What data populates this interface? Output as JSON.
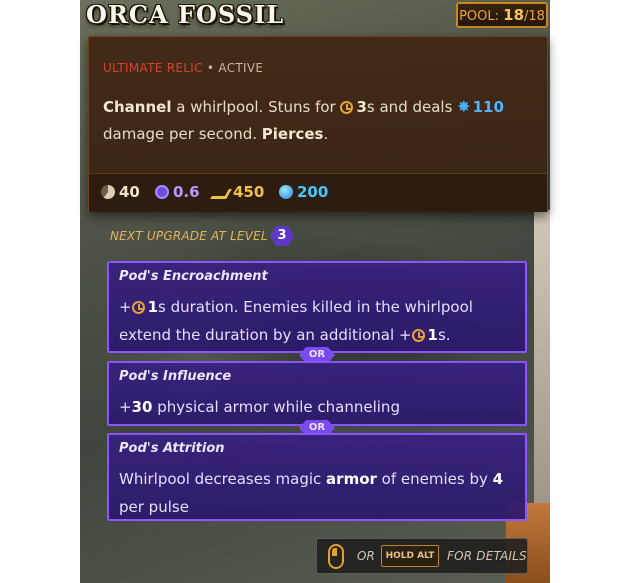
{
  "tooltip": {
    "title": "ORCA FOSSIL",
    "pool": {
      "label": "POOL:",
      "current": "18",
      "max": "/18"
    },
    "category": "ULTIMATE RELIC",
    "separator": "•",
    "state": "ACTIVE",
    "description": {
      "t1": "Channel",
      "t2": " a whirlpool. Stuns for ",
      "t3": "3",
      "t4": "s and deals ",
      "t5": "110",
      "t6": "damage per second. ",
      "t7": "Pierces",
      "t8": "."
    },
    "stats": [
      {
        "icon": "cooldown-icon",
        "value": "40"
      },
      {
        "icon": "cast-time-icon",
        "value": "0.6"
      },
      {
        "icon": "range-icon",
        "value": "450"
      },
      {
        "icon": "mana-icon",
        "value": "200"
      }
    ]
  },
  "upgrades": {
    "heading": "NEXT UPGRADE AT LEVEL",
    "level": "3",
    "or_label": "OR",
    "items": [
      {
        "name": "Pod's Encroachment",
        "p1": "+",
        "p2": "1",
        "p3": "s duration. Enemies killed in the whirlpool extend the duration by an additional +",
        "p4": "1",
        "p5": "s."
      },
      {
        "name": "Pod's Influence",
        "p1": "+",
        "p2": "30",
        "p3": " physical armor while channeling"
      },
      {
        "name": "Pod's Attrition",
        "p1": "Whirlpool decreases magic ",
        "p2": "armor",
        "p3": " of enemies by ",
        "p4": "4",
        "p5": " per pulse"
      }
    ]
  },
  "footer": {
    "or_label": "OR",
    "key_label": "HOLD ALT",
    "details_label": "FOR DETAILS"
  },
  "colors": {
    "title": "#fbf7ee",
    "category": "#d7412d",
    "damage_blue": "#4fb3ff",
    "upgrade_border": "#8a55ff",
    "accent_orange": "#e9a53a"
  }
}
